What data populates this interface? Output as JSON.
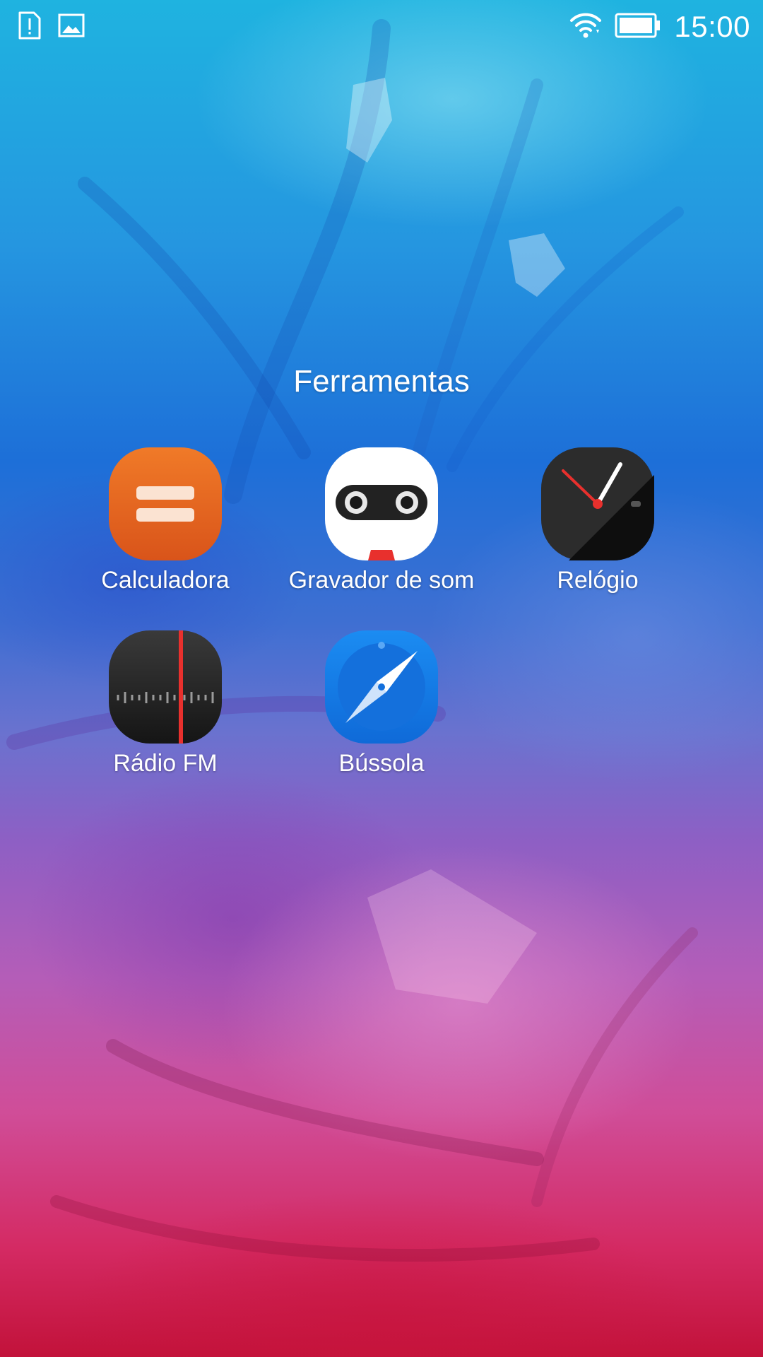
{
  "status_bar": {
    "left_icons": [
      "sim-alert-icon",
      "image-notification-icon"
    ],
    "right_icons": [
      "wifi-icon",
      "battery-icon"
    ],
    "time": "15:00"
  },
  "folder": {
    "title": "Ferramentas",
    "apps": [
      {
        "label": "Calculadora",
        "icon": "calculator-icon",
        "color": "#e8621c"
      },
      {
        "label": "Gravador de som",
        "icon": "sound-recorder-icon",
        "color": "#ffffff"
      },
      {
        "label": "Relógio",
        "icon": "clock-icon",
        "color": "#1c1c1c"
      },
      {
        "label": "Rádio FM",
        "icon": "fm-radio-icon",
        "color": "#2a2a2a"
      },
      {
        "label": "Bússola",
        "icon": "compass-icon",
        "color": "#1a7fe6"
      }
    ]
  }
}
